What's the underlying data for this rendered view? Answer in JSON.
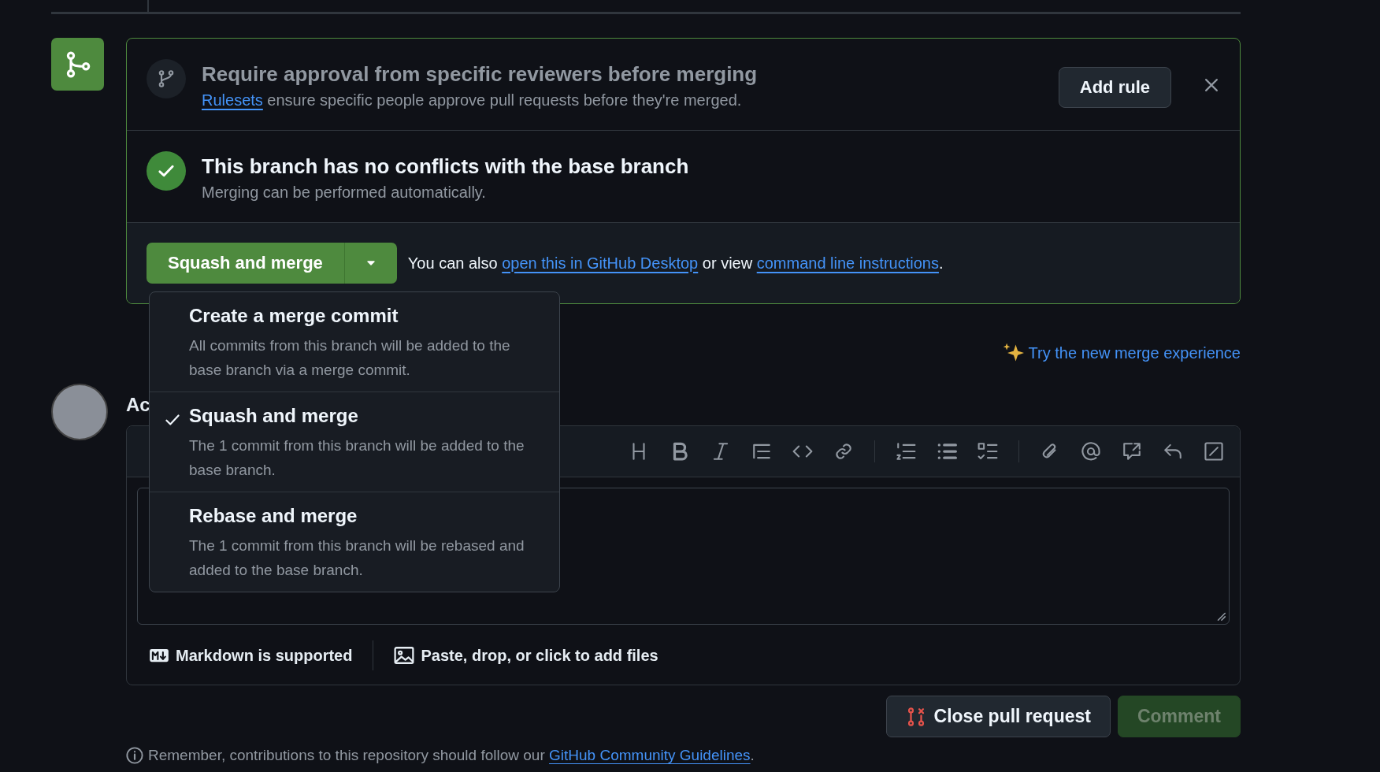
{
  "rule_prompt": {
    "title": "Require approval from specific reviewers before merging",
    "link": "Rulesets",
    "text": " ensure specific people approve pull requests before they're merged.",
    "button": "Add rule"
  },
  "status": {
    "title": "This branch has no conflicts with the base branch",
    "subtitle": "Merging can be performed automatically."
  },
  "merge": {
    "button": "Squash and merge",
    "before": "You can also ",
    "link1": "open this in GitHub Desktop",
    "middle": " or view ",
    "link2": "command line instructions",
    "after": "."
  },
  "merge_menu": [
    {
      "title": "Create a merge commit",
      "description": "All commits from this branch will be added to the base branch via a merge commit.",
      "selected": false
    },
    {
      "title": "Squash and merge",
      "description": "The 1 commit from this branch will be added to the base branch.",
      "selected": true
    },
    {
      "title": "Rebase and merge",
      "description": "The 1 commit from this branch will be rebased and added to the base branch.",
      "selected": false
    }
  ],
  "try_link": "Try the new merge experience",
  "comment": {
    "heading": "Ac",
    "markdown_note": "Markdown is supported",
    "attach_note": "Paste, drop, or click to add files"
  },
  "actions": [
    {
      "label": "Close pull request",
      "kind": "close"
    },
    {
      "label": "Comment",
      "kind": "primary",
      "disabled": true
    }
  ],
  "guidelines": {
    "text": "Remember, contributions to this repository should follow our ",
    "link": "GitHub Community Guidelines",
    "after": "."
  }
}
